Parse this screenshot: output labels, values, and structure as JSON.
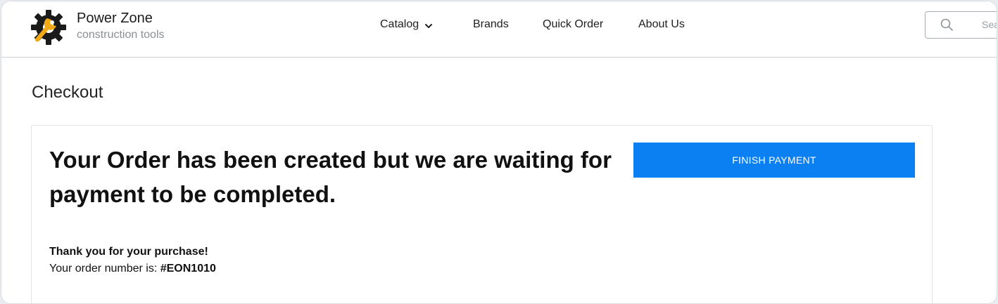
{
  "brand": {
    "name": "Power Zone",
    "tagline": "construction tools",
    "logo_icon": "gear-wrench-icon",
    "logo_colors": {
      "gear": "#1a1a1a",
      "wrench": "#f2a916"
    }
  },
  "nav": {
    "items": [
      {
        "label": "Catalog",
        "has_dropdown": true
      },
      {
        "label": "Brands"
      },
      {
        "label": "Quick Order"
      },
      {
        "label": "About Us"
      }
    ]
  },
  "search": {
    "placeholder": "Search",
    "icon": "search-icon"
  },
  "page": {
    "title": "Checkout"
  },
  "order": {
    "headline": "Your Order has been created but we are waiting for payment to be completed.",
    "finish_label": "FINISH PAYMENT",
    "thanks": "Thank you for your purchase!",
    "number_prefix": "Your order number is: ",
    "number": "#EON1010"
  },
  "colors": {
    "accent": "#0a80f2",
    "border": "#cfd3d8"
  }
}
